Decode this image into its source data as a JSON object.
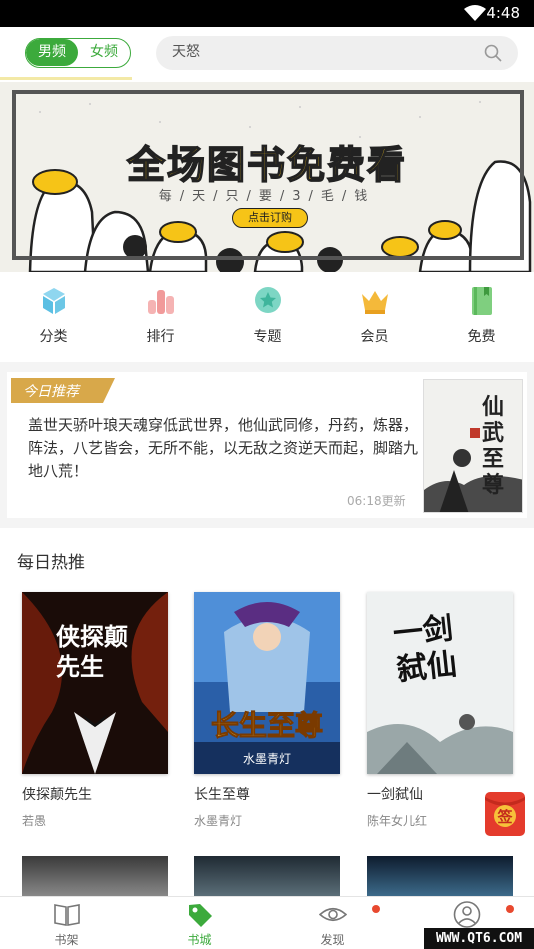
{
  "status_bar": {
    "time": "4:48"
  },
  "top_bar": {
    "gender_tabs": [
      "男频",
      "女频"
    ],
    "selected_gender": "男频",
    "search": {
      "value": "天怒"
    }
  },
  "banner": {
    "headline": "全场图书免费看",
    "subline": "每/天/只/要/3/毛/钱",
    "cta": "点击订购"
  },
  "categories": [
    {
      "label": "分类",
      "icon": "category-icon",
      "color": "#6cc7e6"
    },
    {
      "label": "排行",
      "icon": "ranking-icon",
      "color": "#f19a9a"
    },
    {
      "label": "专题",
      "icon": "topic-icon",
      "color": "#5cc8b3"
    },
    {
      "label": "会员",
      "icon": "vip-crown-icon",
      "color": "#f4b93a"
    },
    {
      "label": "免费",
      "icon": "free-book-icon",
      "color": "#6cc36c"
    }
  ],
  "today_recommend": {
    "tag": "今日推荐",
    "text": "盖世天骄叶琅天魂穿低武世界，他仙武同修，丹药，炼器，阵法，八艺皆会，无所不能，以无敌之资逆天而起，脚踏九地八荒！",
    "update_time": "06:18更新",
    "cover_title": "仙武至尊"
  },
  "daily_hot": {
    "title": "每日热推",
    "books": [
      {
        "title": "侠探颠先生",
        "author": "若愚",
        "cover_text": "侠探颠先生"
      },
      {
        "title": "长生至尊",
        "author": "水墨青灯",
        "cover_text": "长生至尊",
        "cover_sub": "水墨青灯"
      },
      {
        "title": "一剑弑仙",
        "author": "陈年女儿红",
        "cover_text": "一剑弑仙"
      }
    ]
  },
  "redpack": {
    "label": "签"
  },
  "bottom_nav": [
    {
      "label": "书架",
      "icon": "bookshelf-icon",
      "active": false
    },
    {
      "label": "书城",
      "icon": "bookstore-tag-icon",
      "active": true
    },
    {
      "label": "发现",
      "icon": "discover-eye-icon",
      "active": false
    },
    {
      "label": "",
      "icon": "profile-icon",
      "active": false
    }
  ],
  "watermark": "WWW.QT6.COM",
  "colors": {
    "accent": "#3caa3c",
    "banner_yellow": "#f6c417",
    "badge_red": "#e8492f"
  }
}
